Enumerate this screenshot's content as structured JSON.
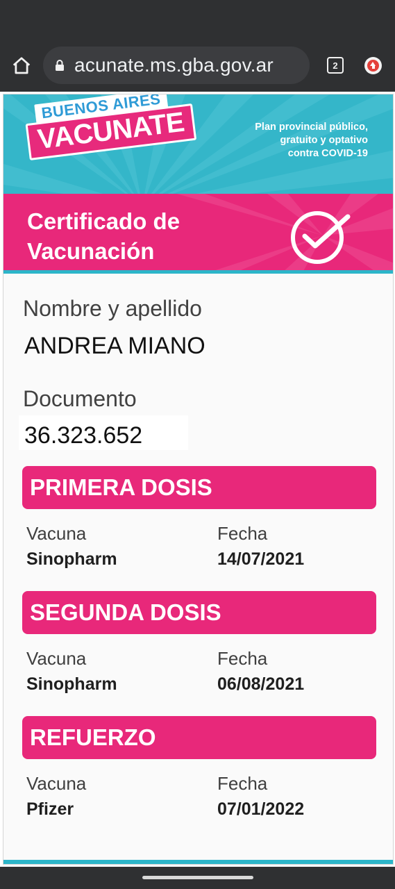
{
  "browser": {
    "url": "acunate.ms.gba.gov.ar",
    "tab_count": "2"
  },
  "header": {
    "logo_top": "BUENOS AIRES",
    "logo_main": "VACUNATE",
    "tagline": "Plan provincial público,\ngratuito y optativo\ncontra COVID-19"
  },
  "certificate": {
    "title": "Certificado de\nVacunación"
  },
  "person": {
    "name_label": "Nombre y apellido",
    "name": "ANDREA MIANO",
    "document_label": "Documento",
    "document": "36.323.652"
  },
  "doses": [
    {
      "title": "PRIMERA DOSIS",
      "vaccine_label": "Vacuna",
      "vaccine": "Sinopharm",
      "date_label": "Fecha",
      "date": "14/07/2021"
    },
    {
      "title": "SEGUNDA DOSIS",
      "vaccine_label": "Vacuna",
      "vaccine": "Sinopharm",
      "date_label": "Fecha",
      "date": "06/08/2021"
    },
    {
      "title": "REFUERZO",
      "vaccine_label": "Vacuna",
      "vaccine": "Pfizer",
      "date_label": "Fecha",
      "date": "07/01/2022"
    }
  ],
  "colors": {
    "brand_pink": "#e8287a",
    "brand_cyan": "#34b6c9",
    "browser_bg": "#2f3032"
  }
}
